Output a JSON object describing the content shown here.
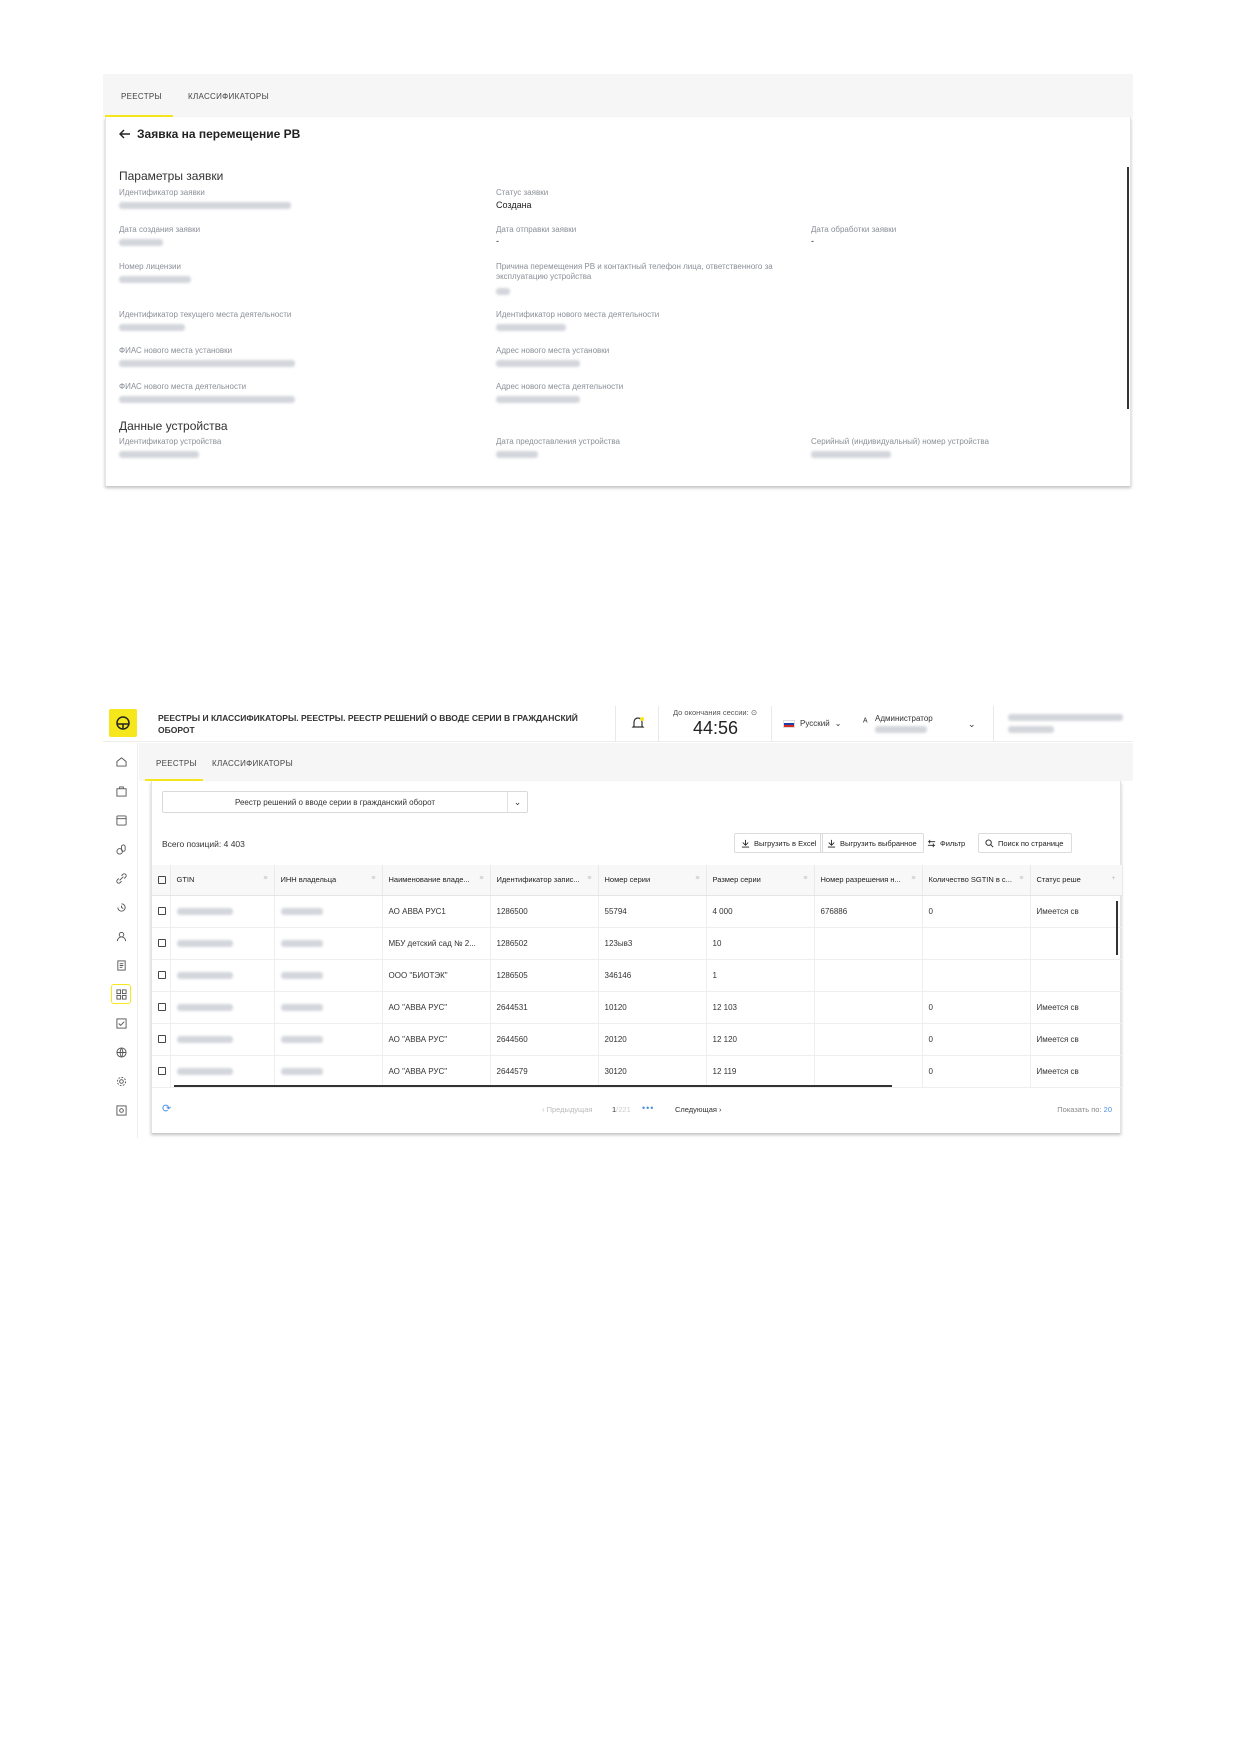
{
  "shot1": {
    "tabs": [
      "РЕЕСТРЫ",
      "КЛАССИФИКАТОРЫ"
    ],
    "back_title": "Заявка на перемещение РВ",
    "section_params": "Параметры заявки",
    "section_device": "Данные устройства",
    "fields": {
      "request_id": "Идентификатор заявки",
      "request_status": "Статус заявки",
      "request_status_value": "Создана",
      "created_date": "Дата создания заявки",
      "sent_date": "Дата отправки заявки",
      "sent_date_value": "-",
      "processed_date": "Дата обработки заявки",
      "processed_date_value": "-",
      "license_number": "Номер лицензии",
      "move_reason": "Причина перемещения РВ и контактный телефон лица, ответственного за эксплуатацию устройства",
      "current_place_id": "Идентификатор текущего места деятельности",
      "new_place_id": "Идентификатор нового места деятельности",
      "fias_install": "ФИАС нового места установки",
      "address_install": "Адрес нового места установки",
      "fias_activity": "ФИАС нового места деятельности",
      "address_activity": "Адрес нового места деятельности",
      "device_id": "Идентификатор устройства",
      "device_date": "Дата предоставления устройства",
      "device_serial": "Серийный (индивидуальный) номер устройства"
    }
  },
  "shot2": {
    "header_title": "РЕЕСТРЫ И КЛАССИФИКАТОРЫ. РЕЕСТРЫ. РЕЕСТР РЕШЕНИЙ О ВВОДЕ СЕРИИ В ГРАЖДАНСКИЙ ОБОРОТ",
    "session_label": "До окончания сессии:",
    "session_timer": "44:56",
    "language": "Русский",
    "user_role": "Администратор",
    "tabs": [
      "РЕЕСТРЫ",
      "КЛАССИФИКАТОРЫ"
    ],
    "registry_select": "Реестр решений о вводе серии в гражданский оборот",
    "total_label": "Всего позиций: 4 403",
    "buttons": {
      "export_excel": "Выгрузить в Excel",
      "export_selected": "Выгрузить выбранное",
      "filter": "Фильтр",
      "search_page": "Поиск по странице"
    },
    "columns": [
      "GTIN",
      "ИНН владельца",
      "Наименование владе...",
      "Идентификатор запис...",
      "Номер серии",
      "Размер серии",
      "Номер разрешения н...",
      "Количество SGTIN в с...",
      "Статус реше"
    ],
    "rows": [
      {
        "owner": "АО АВВА РУС1",
        "record_id": "1286500",
        "series": "55794",
        "size": "4 000",
        "permit": "676886",
        "sgtin": "0",
        "status": "Имеется св"
      },
      {
        "owner": "МБУ детский сад № 2...",
        "record_id": "1286502",
        "series": "123ыв3",
        "size": "10",
        "permit": "",
        "sgtin": "",
        "status": ""
      },
      {
        "owner": "ООО \"БИОТЭК\"",
        "record_id": "1286505",
        "series": "346146",
        "size": "1",
        "permit": "",
        "sgtin": "",
        "status": ""
      },
      {
        "owner": "АО \"АВВА РУС\"",
        "record_id": "2644531",
        "series": "10120",
        "size": "12 103",
        "permit": "",
        "sgtin": "0",
        "status": "Имеется св"
      },
      {
        "owner": "АО \"АВВА РУС\"",
        "record_id": "2644560",
        "series": "20120",
        "size": "12 120",
        "permit": "",
        "sgtin": "0",
        "status": "Имеется св"
      },
      {
        "owner": "АО \"АВВА РУС\"",
        "record_id": "2644579",
        "series": "30120",
        "size": "12 119",
        "permit": "",
        "sgtin": "0",
        "status": "Имеется св"
      }
    ],
    "pager": {
      "prev": "Предыдущая",
      "page_current": "1",
      "page_total": "/221",
      "next": "Следующая",
      "show_label": "Показать по:",
      "show_value": "20"
    },
    "colors": {
      "accent": "#f6e71d",
      "link": "#4a90e2"
    }
  }
}
